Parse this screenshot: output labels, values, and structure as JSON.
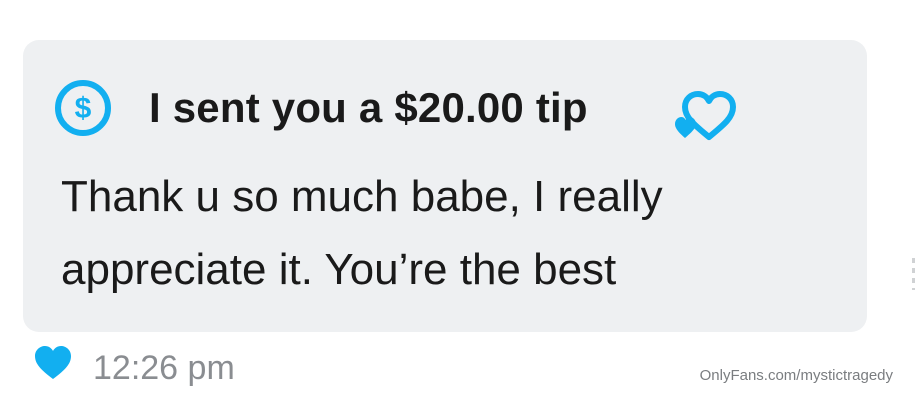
{
  "message": {
    "tip_text": "I sent you a $20.00 tip",
    "body": "Thank u so much babe, I really\nappreciate it. You’re the best",
    "time": "12:26 pm",
    "tip_icon": "dollar-circle-icon",
    "reaction_icon": "hearts-icon",
    "like_icon": "heart-icon"
  },
  "watermark": "OnlyFans.com/mystictragedy",
  "colors": {
    "accent": "#12aff0",
    "bubble": "#eef0f2",
    "text": "#1a1a1a",
    "muted": "#8a8d91"
  }
}
